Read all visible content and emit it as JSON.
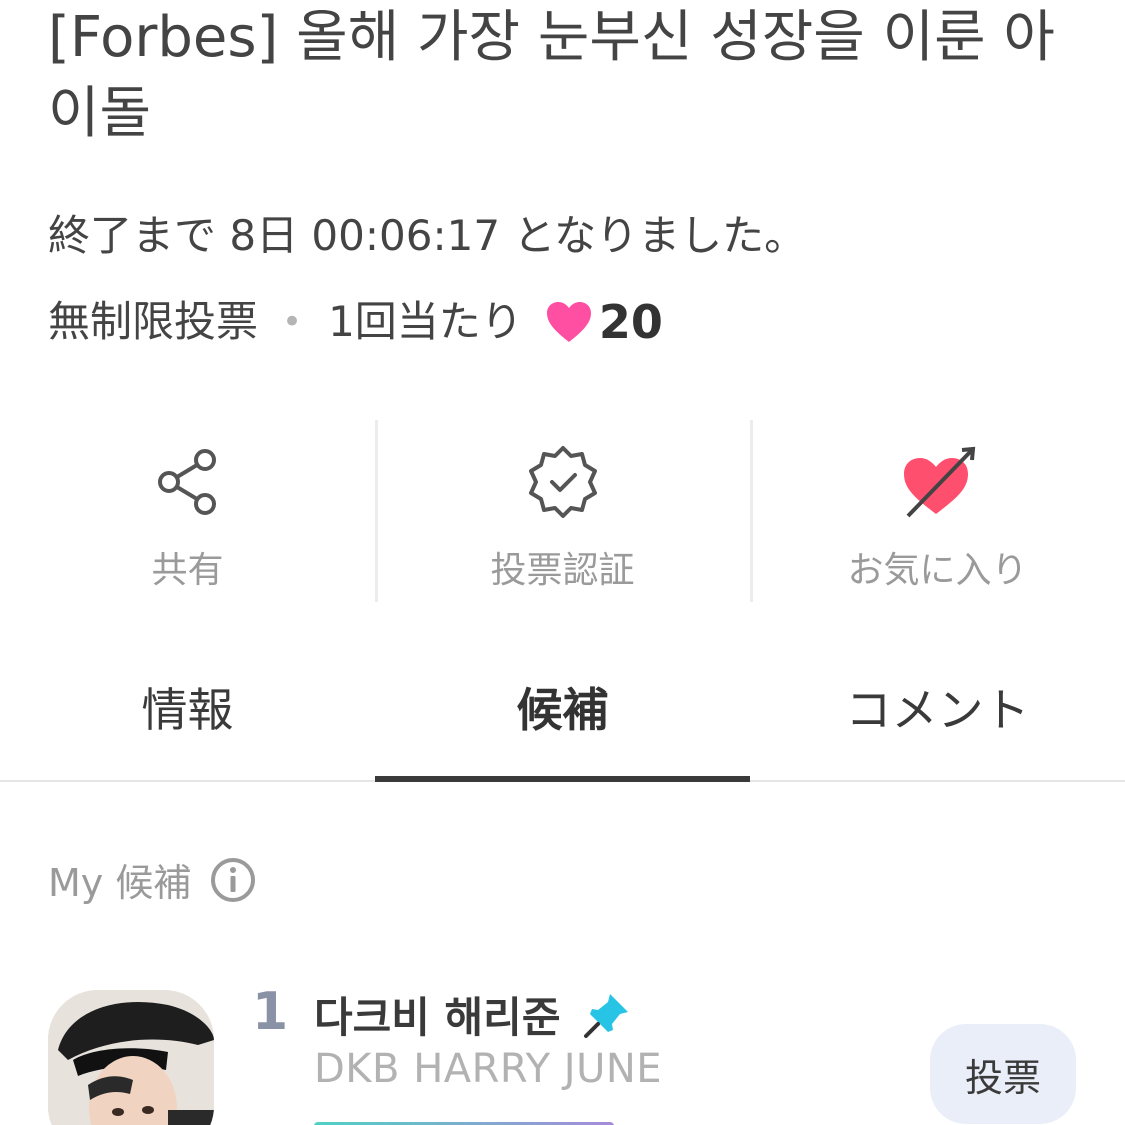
{
  "title": "[Forbes] 올해 가장 눈부신 성장을 이룬 아이돌",
  "countdown": "終了まで 8日 00:06:17 となりました。",
  "vote_rule": {
    "type": "無制限投票",
    "separator": "•",
    "per_vote": "1回当たり",
    "hearts": "20",
    "heart_color": "#ff4fa3"
  },
  "actions": [
    {
      "label": "共有",
      "icon": "share-icon"
    },
    {
      "label": "投票認証",
      "icon": "verified-badge-icon"
    },
    {
      "label": "お気に入り",
      "icon": "heart-arrow-icon"
    }
  ],
  "tabs": [
    {
      "label": "情報",
      "active": false
    },
    {
      "label": "候補",
      "active": true
    },
    {
      "label": "コメント",
      "active": false
    }
  ],
  "my_candidate": {
    "label": "My 候補",
    "info_icon": "info-icon"
  },
  "candidate": {
    "rank": "1",
    "name_kr": "다크비 해리준",
    "name_en": "DKB HARRY JUNE",
    "vote_label": "投票",
    "pin_icon": "pin-icon"
  },
  "colors": {
    "accent_pink": "#ff4fa3",
    "pin_cyan": "#27c4e6",
    "vote_button_bg": "#e9eef8"
  }
}
